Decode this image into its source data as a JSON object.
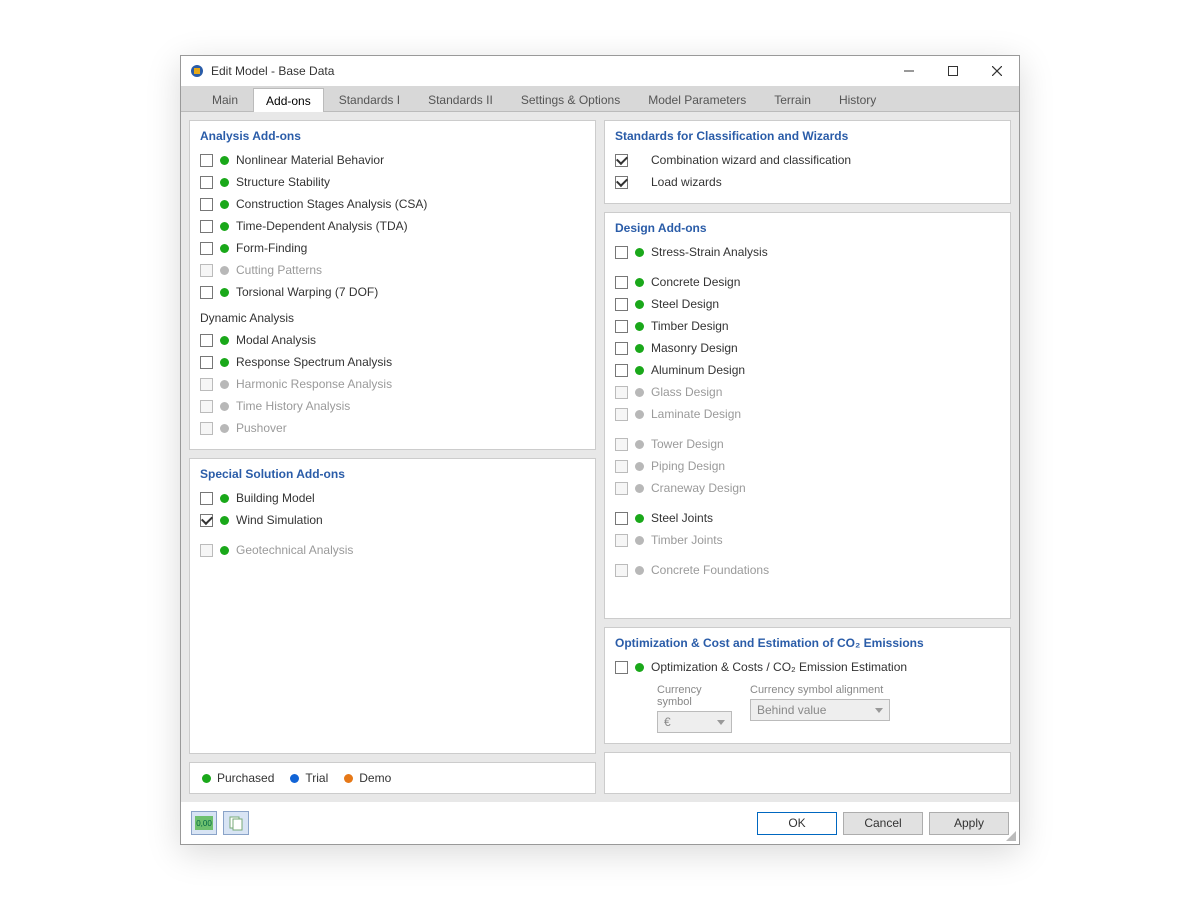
{
  "window": {
    "title": "Edit Model - Base Data"
  },
  "tabs": [
    "Main",
    "Add-ons",
    "Standards I",
    "Standards II",
    "Settings & Options",
    "Model Parameters",
    "Terrain",
    "History"
  ],
  "active_tab": "Add-ons",
  "sections": {
    "analysis": {
      "title": "Analysis Add-ons",
      "items": [
        {
          "label": "Nonlinear Material Behavior",
          "status": "green",
          "checked": false
        },
        {
          "label": "Structure Stability",
          "status": "green",
          "checked": false
        },
        {
          "label": "Construction Stages Analysis (CSA)",
          "status": "green",
          "checked": false
        },
        {
          "label": "Time-Dependent Analysis (TDA)",
          "status": "green",
          "checked": false
        },
        {
          "label": "Form-Finding",
          "status": "green",
          "checked": false
        },
        {
          "label": "Cutting Patterns",
          "status": "grey",
          "checked": false,
          "disabled": true
        },
        {
          "label": "Torsional Warping (7 DOF)",
          "status": "green",
          "checked": false
        }
      ],
      "dynamic_title": "Dynamic Analysis",
      "dynamic_items": [
        {
          "label": "Modal Analysis",
          "status": "green",
          "checked": false
        },
        {
          "label": "Response Spectrum Analysis",
          "status": "green",
          "checked": false
        },
        {
          "label": "Harmonic Response Analysis",
          "status": "grey",
          "checked": false,
          "disabled": true
        },
        {
          "label": "Time History Analysis",
          "status": "grey",
          "checked": false,
          "disabled": true
        },
        {
          "label": "Pushover",
          "status": "grey",
          "checked": false,
          "disabled": true
        }
      ]
    },
    "special": {
      "title": "Special Solution Add-ons",
      "items": [
        {
          "label": "Building Model",
          "status": "green",
          "checked": false
        },
        {
          "label": "Wind Simulation",
          "status": "green",
          "checked": true
        }
      ],
      "tail": [
        {
          "label": "Geotechnical Analysis",
          "status": "green",
          "checked": false,
          "disabled": true
        }
      ]
    },
    "standards": {
      "title": "Standards for Classification and Wizards",
      "items": [
        {
          "label": "Combination wizard and classification",
          "checked": true
        },
        {
          "label": "Load wizards",
          "checked": true
        }
      ]
    },
    "design": {
      "title": "Design Add-ons",
      "groups": [
        [
          {
            "label": "Stress-Strain Analysis",
            "status": "green",
            "checked": false
          }
        ],
        [
          {
            "label": "Concrete Design",
            "status": "green",
            "checked": false
          },
          {
            "label": "Steel Design",
            "status": "green",
            "checked": false
          },
          {
            "label": "Timber Design",
            "status": "green",
            "checked": false
          },
          {
            "label": "Masonry Design",
            "status": "green",
            "checked": false
          },
          {
            "label": "Aluminum Design",
            "status": "green",
            "checked": false
          },
          {
            "label": "Glass Design",
            "status": "grey",
            "checked": false,
            "disabled": true
          },
          {
            "label": "Laminate Design",
            "status": "grey",
            "checked": false,
            "disabled": true
          }
        ],
        [
          {
            "label": "Tower Design",
            "status": "grey",
            "checked": false,
            "disabled": true
          },
          {
            "label": "Piping Design",
            "status": "grey",
            "checked": false,
            "disabled": true
          },
          {
            "label": "Craneway Design",
            "status": "grey",
            "checked": false,
            "disabled": true
          }
        ],
        [
          {
            "label": "Steel Joints",
            "status": "green",
            "checked": false
          },
          {
            "label": "Timber Joints",
            "status": "grey",
            "checked": false,
            "disabled": true
          }
        ],
        [
          {
            "label": "Concrete Foundations",
            "status": "grey",
            "checked": false,
            "disabled": true
          }
        ]
      ]
    },
    "optimization": {
      "title": "Optimization & Cost and Estimation of CO₂ Emissions",
      "item": {
        "label": "Optimization & Costs / CO₂ Emission Estimation",
        "status": "green",
        "checked": false
      },
      "currency_label": "Currency symbol",
      "currency_value": "€",
      "alignment_label": "Currency symbol alignment",
      "alignment_value": "Behind value"
    }
  },
  "legend": {
    "purchased": "Purchased",
    "trial": "Trial",
    "demo": "Demo"
  },
  "buttons": {
    "ok": "OK",
    "cancel": "Cancel",
    "apply": "Apply"
  }
}
